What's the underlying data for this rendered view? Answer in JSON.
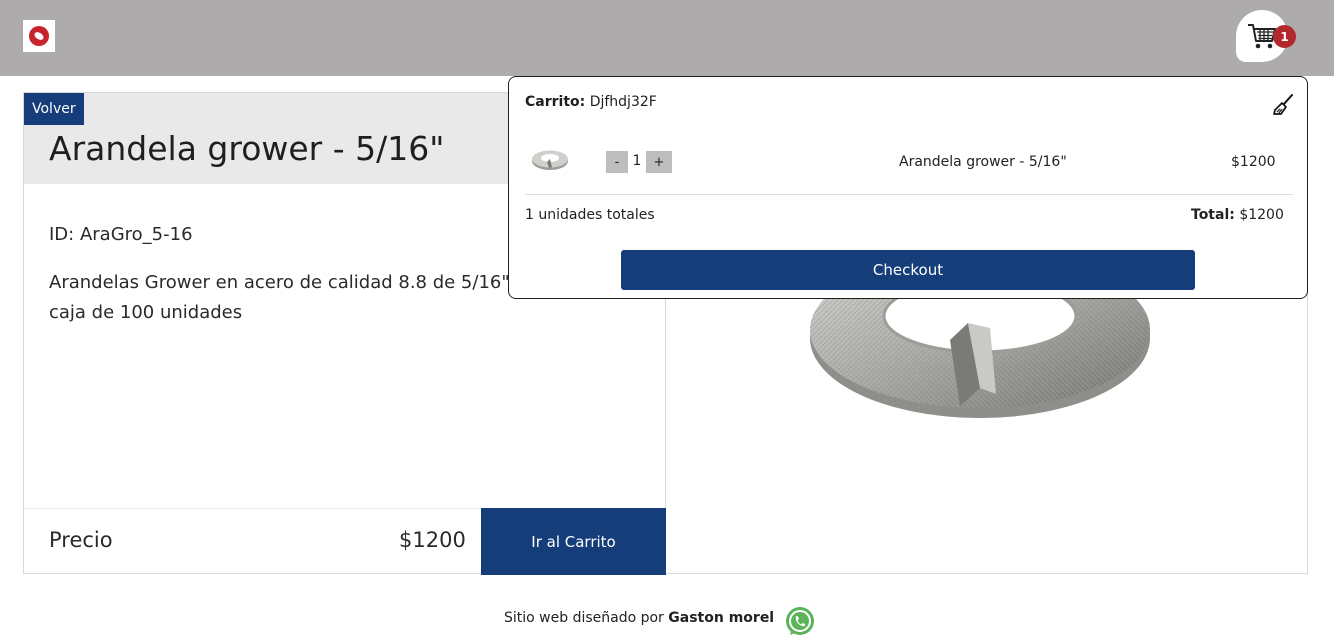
{
  "header": {
    "logo_icon": "brand-logo-icon",
    "cart_icon": "shopping-cart-icon",
    "cart_count": "1",
    "badge_color": "#b3282d"
  },
  "product": {
    "back_label": "Volver",
    "title": "Arandela grower - 5/16\"",
    "id_text": "ID: AraGro_5-16",
    "description": "Arandelas Grower en acero de calidad 8.8 de 5/16\" c precio es por caja de 100 unidades",
    "price_label": "Precio",
    "price_value": "$1200",
    "cart_button_label": "Ir al Carrito",
    "image": "lock-washer-image"
  },
  "cart": {
    "heading_label": "Carrito:",
    "cart_id": "Djfhdj32F",
    "clear_icon": "broom-icon",
    "items": [
      {
        "thumb": "lock-washer-thumbnail",
        "minus_label": "-",
        "quantity": "1",
        "plus_label": "+",
        "name": "Arandela grower - 5/16\"",
        "price": "$1200"
      }
    ],
    "units_text": "1 unidades totales",
    "total_label": "Total:",
    "total_value": "$1200",
    "checkout_label": "Checkout"
  },
  "footer": {
    "text": "Sitio web diseñado por",
    "author": "Gaston morel",
    "whatsapp_icon": "whatsapp-icon"
  },
  "colors": {
    "accent": "#153d79",
    "topbar": "#adabac",
    "header_bg": "#e9e9e9"
  }
}
